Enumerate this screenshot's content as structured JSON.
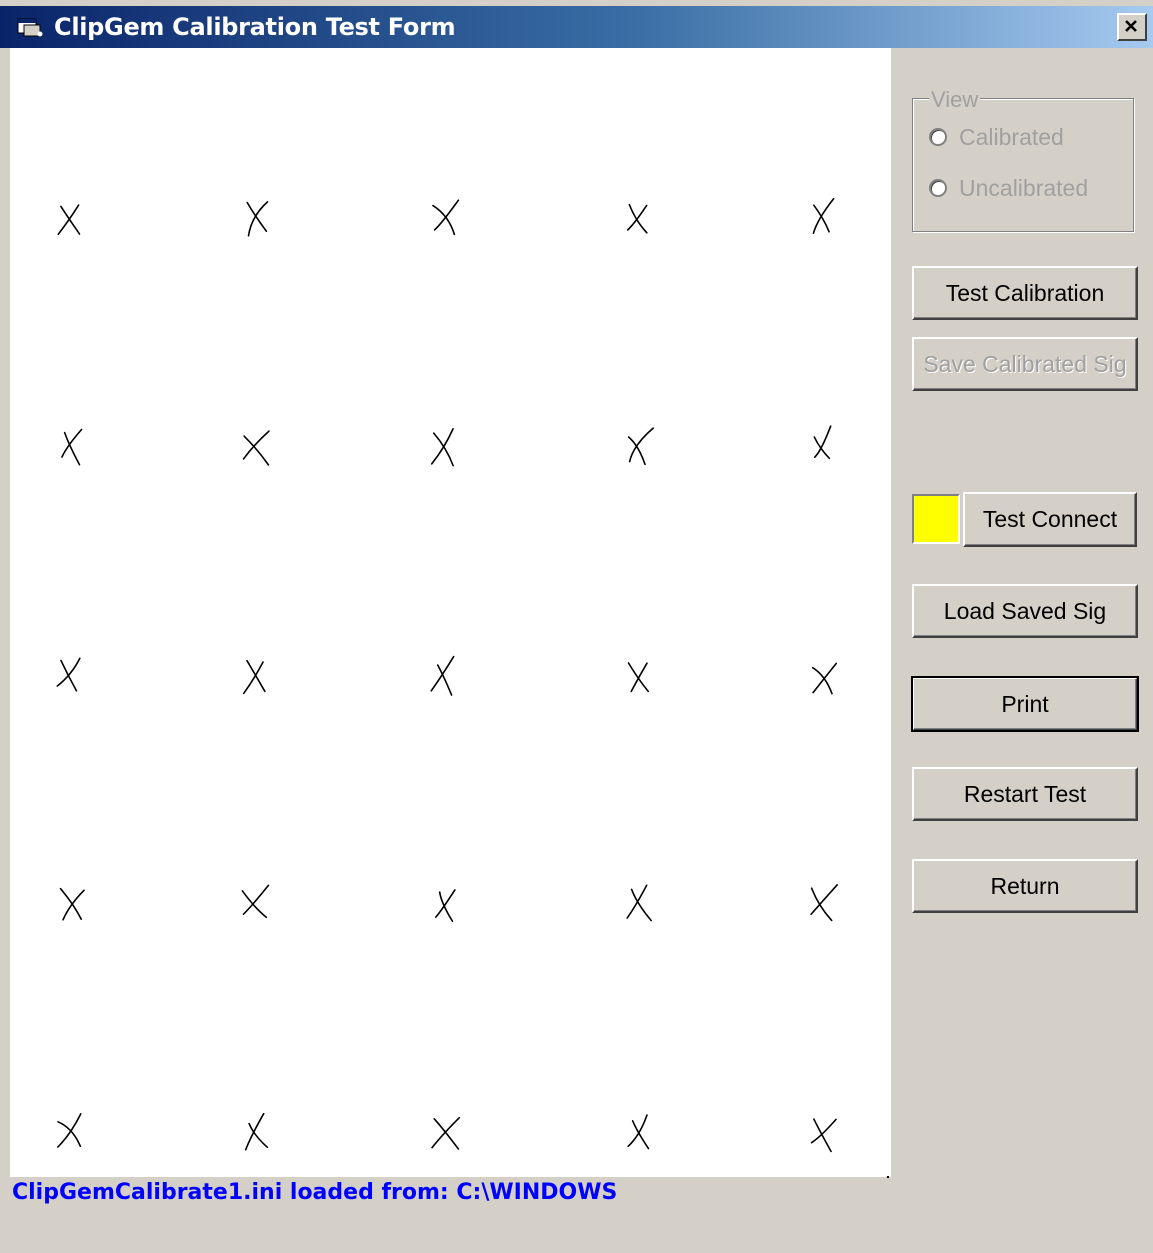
{
  "window": {
    "title": "ClipGem Calibration Test Form",
    "close_label": "×"
  },
  "view_group": {
    "legend": "View",
    "options": [
      {
        "label": "Calibrated",
        "selected": false,
        "enabled": false
      },
      {
        "label": "Uncalibrated",
        "selected": false,
        "enabled": false
      }
    ]
  },
  "buttons": {
    "test_calibration": "Test Calibration",
    "save_calibrated_sig": "Save Calibrated Sig",
    "test_connect": "Test Connect",
    "load_saved_sig": "Load Saved Sig",
    "print": "Print",
    "restart_test": "Restart Test",
    "return": "Return"
  },
  "connection_indicator_color": "#ffff00",
  "status_text": "ClipGemCalibrate1.ini loaded from: C:\\WINDOWS",
  "calibration_marks": {
    "rows": 5,
    "columns": 5,
    "symbol": "X"
  }
}
